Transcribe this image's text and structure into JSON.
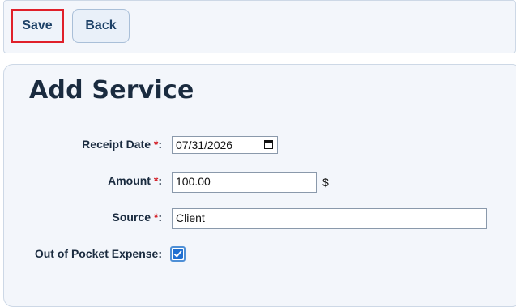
{
  "toolbar": {
    "save_label": "Save",
    "back_label": "Back"
  },
  "page": {
    "title": "Add Service"
  },
  "form": {
    "required_marker": "*",
    "receipt_date": {
      "label": "Receipt Date",
      "value": "07/31/2026"
    },
    "amount": {
      "label": "Amount",
      "value": "100.00",
      "currency_symbol": "$"
    },
    "source": {
      "label": "Source",
      "value": "Client"
    },
    "out_of_pocket": {
      "label": "Out of Pocket Expense:",
      "checked": true
    }
  },
  "colors": {
    "accent": "#1f6fd1",
    "required": "#d3222a",
    "highlight_border": "#e0202a"
  }
}
